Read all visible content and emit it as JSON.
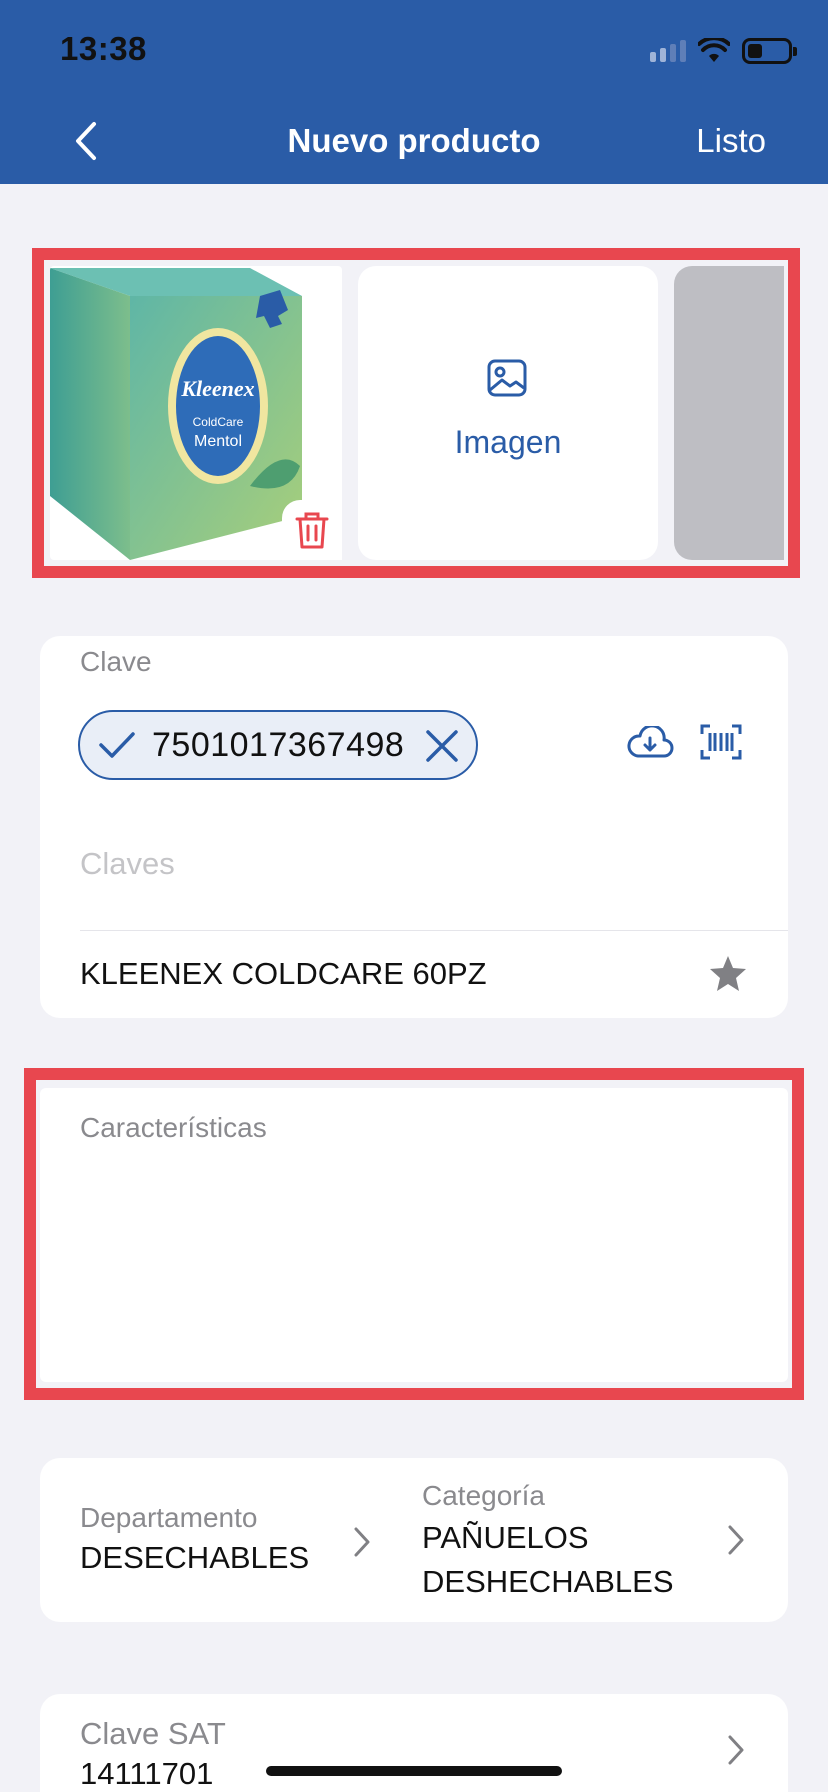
{
  "status_bar": {
    "time": "13:38"
  },
  "nav": {
    "title": "Nuevo producto",
    "done_label": "Listo"
  },
  "images": {
    "add_label": "Imagen"
  },
  "clave": {
    "label": "Clave",
    "chip_value": "7501017367498",
    "claves_placeholder": "Claves",
    "product_name": "KLEENEX COLDCARE 60PZ"
  },
  "caracteristicas": {
    "label": "Características"
  },
  "departamento": {
    "label": "Departamento",
    "value": "DESECHABLES"
  },
  "categoria": {
    "label": "Categoría",
    "value": "PAÑUELOS DESHECHABLES"
  },
  "clave_sat": {
    "label": "Clave SAT",
    "value": "14111701"
  },
  "colors": {
    "primary": "#2A5CA7",
    "background": "#F2F2F7",
    "highlight": "#E8474F",
    "delete_red": "#E8474F"
  }
}
